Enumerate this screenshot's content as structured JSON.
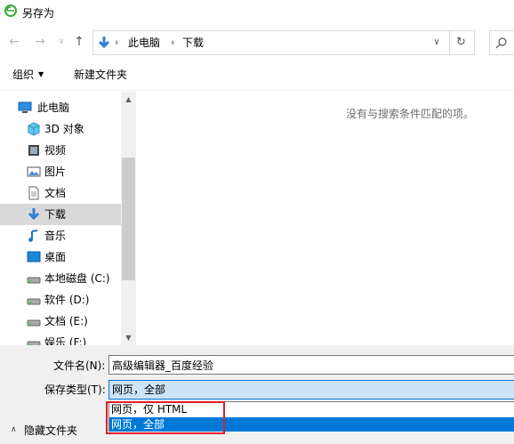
{
  "window": {
    "title": "另存为"
  },
  "address": {
    "crumbs": [
      "此电脑",
      "下载"
    ]
  },
  "toolbar": {
    "organize_label": "组织",
    "new_folder_label": "新建文件夹"
  },
  "nav": {
    "items": [
      {
        "label": "此电脑",
        "icon": "computer-icon"
      },
      {
        "label": "3D 对象",
        "icon": "3d-objects-icon"
      },
      {
        "label": "视频",
        "icon": "video-icon"
      },
      {
        "label": "图片",
        "icon": "picture-icon"
      },
      {
        "label": "文档",
        "icon": "document-icon"
      },
      {
        "label": "下载",
        "icon": "download-icon",
        "selected": true
      },
      {
        "label": "音乐",
        "icon": "music-icon"
      },
      {
        "label": "桌面",
        "icon": "desktop-icon"
      },
      {
        "label": "本地磁盘 (C:)",
        "icon": "drive-icon"
      },
      {
        "label": "软件 (D:)",
        "icon": "drive-icon"
      },
      {
        "label": "文档 (E:)",
        "icon": "drive-icon"
      },
      {
        "label": "娱乐 (F:)",
        "icon": "drive-icon"
      }
    ]
  },
  "content": {
    "empty_message": "没有与搜索条件匹配的项。"
  },
  "form": {
    "filename_label": "文件名(N):",
    "filename_value": "高级编辑器_百度经验",
    "type_label": "保存类型(T):",
    "type_value": "网页，全部",
    "type_options": [
      "网页，仅 HTML",
      "网页，全部"
    ],
    "hide_folders_label": "隐藏文件夹"
  },
  "colors": {
    "accent": "#0078d7",
    "selection_bg": "#cce4f7",
    "annotation_red": "#e0202a"
  }
}
